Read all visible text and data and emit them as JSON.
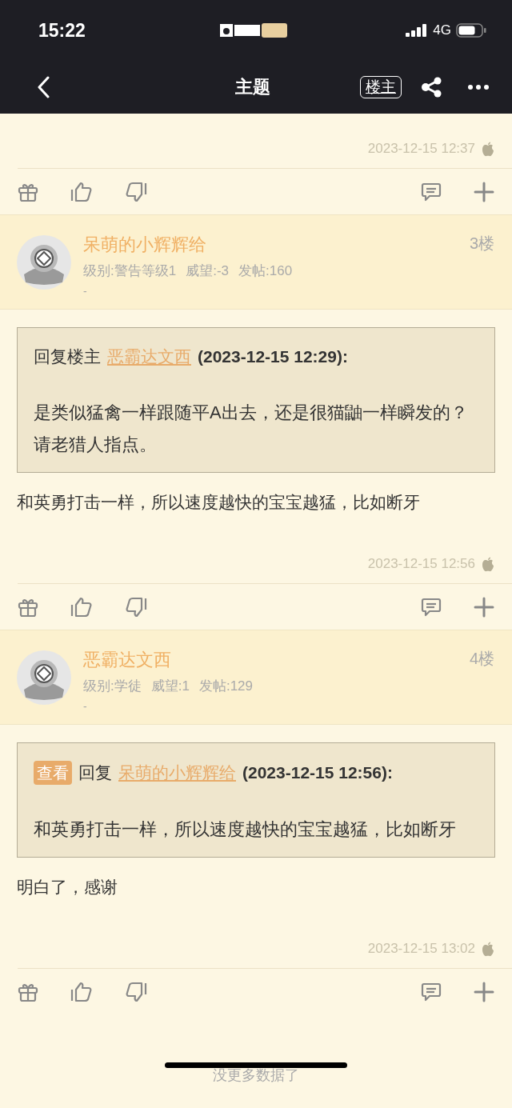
{
  "status_bar": {
    "time": "15:22",
    "network": "4G"
  },
  "nav": {
    "title": "主题",
    "author_button": "楼主"
  },
  "posts": [
    {
      "kind": "tail",
      "timestamp": "2023-12-15 12:37"
    },
    {
      "kind": "full",
      "author": "呆萌的小辉辉给",
      "floor": "3楼",
      "level": "级别:警告等级1",
      "prestige": "威望:-3",
      "post_count": "发帖:160",
      "signature": "-",
      "quote": {
        "prefix": "回复楼主",
        "author": "恶霸达文西",
        "time": "(2023-12-15 12:29):",
        "text": "是类似猛禽一样跟随平A出去，还是很猫鼬一样瞬发的？请老猎人指点。"
      },
      "body": "和英勇打击一样，所以速度越快的宝宝越猛，比如断牙",
      "timestamp": "2023-12-15 12:56"
    },
    {
      "kind": "full",
      "author": "恶霸达文西",
      "floor": "4楼",
      "level": "级别:学徒",
      "prestige": "威望:1",
      "post_count": "发帖:129",
      "signature": "-",
      "quote": {
        "view_tag": "查看",
        "prefix": "回复",
        "author": "呆萌的小辉辉给",
        "time": "(2023-12-15 12:56):",
        "text": "和英勇打击一样，所以速度越快的宝宝越猛，比如断牙"
      },
      "body": "明白了，感谢",
      "timestamp": "2023-12-15 13:02"
    }
  ],
  "footer": "没更多数据了"
}
